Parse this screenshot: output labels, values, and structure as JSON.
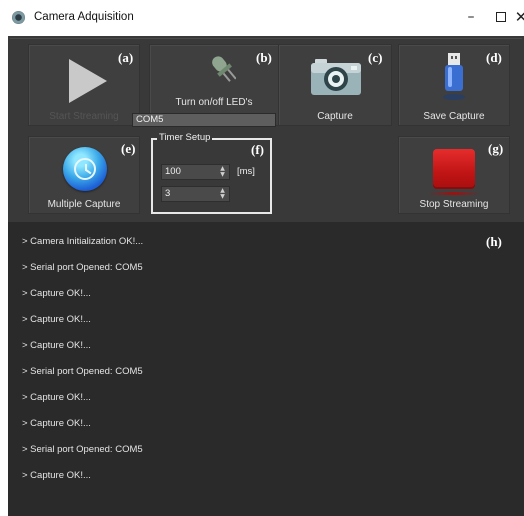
{
  "window": {
    "title": "Camera Adquisition",
    "minimize_glyph": "–",
    "close_glyph": "✕"
  },
  "toolbar": {
    "start_streaming": {
      "tag": "(a)",
      "label": "Start Streaming",
      "enabled": false,
      "icon": "play-icon"
    },
    "led": {
      "tag": "(b)",
      "label": "Turn on/off LED's",
      "port_value": "COM5",
      "icon": "led-icon"
    },
    "capture": {
      "tag": "(c)",
      "label": "Capture",
      "icon": "camera-icon"
    },
    "save_capture": {
      "tag": "(d)",
      "label": "Save Capture",
      "icon": "usb-drive-icon"
    },
    "multiple_capture": {
      "tag": "(e)",
      "label": "Multiple Capture",
      "icon": "clock-icon"
    },
    "timer_setup": {
      "tag": "(f)",
      "legend": "Timer Setup",
      "interval_value": "100",
      "interval_unit": "[ms]",
      "count_value": "3"
    },
    "stop_streaming": {
      "tag": "(g)",
      "label": "Stop Streaming",
      "icon": "stop-icon"
    }
  },
  "log": {
    "tag": "(h)",
    "lines": [
      "> Camera Initialization OK!...",
      "> Serial port Opened: COM5",
      "> Capture OK!...",
      "> Capture OK!...",
      "> Capture OK!...",
      "> Serial port Opened: COM5",
      "> Capture OK!...",
      "> Capture OK!...",
      "> Serial port Opened: COM5",
      "> Capture OK!..."
    ]
  },
  "colors": {
    "window_bg": "#2a2a2a",
    "toolbar_bg": "#393939",
    "button_bg": "#3f3f3f",
    "stop_red": "#d42020",
    "clock_blue": "#3ba9e9"
  }
}
